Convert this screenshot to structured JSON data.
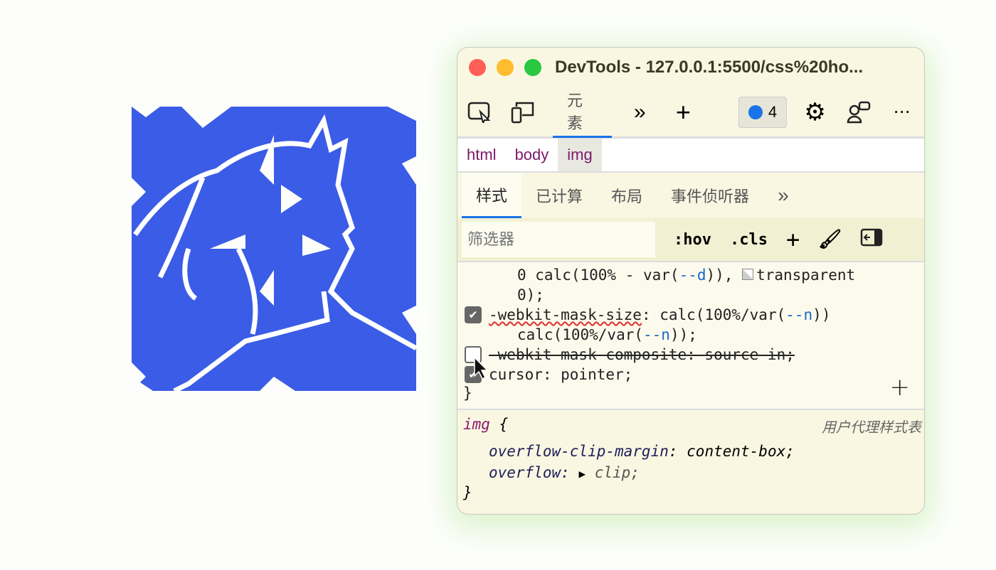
{
  "window": {
    "title": "DevTools - 127.0.0.1:5500/css%20ho...",
    "traffic_colors": [
      "#fe5f57",
      "#febc2e",
      "#28c840"
    ]
  },
  "toolbar": {
    "elements_tab": "元素",
    "issues_count": "4",
    "accent": "#1a73e8"
  },
  "breadcrumb": [
    "html",
    "body",
    "img"
  ],
  "subtabs": [
    "样式",
    "已计算",
    "布局",
    "事件侦听器"
  ],
  "filter": {
    "placeholder": "筛选器",
    "hov": ":hov",
    "cls": ".cls"
  },
  "rules": {
    "line1a": "0 calc(100% - var(",
    "line1var": "--d",
    "line1b": ")), ",
    "line1c": "transparent",
    "line2": "0);",
    "mask_size_prop": "-webkit-mask-size",
    "mask_size_v1": ": calc(100%/var(",
    "var_n": "--n",
    "mask_size_v1b": "))",
    "mask_size_v2a": "calc(100%/var(",
    "mask_size_v2b": "));",
    "composite": "-webkit-mask-composite: source-in;",
    "cursor_prop": "cursor",
    "cursor_val": ": pointer;",
    "close": "}"
  },
  "ua_rule": {
    "selector": "img",
    "open": " {",
    "source": "用户代理样式表",
    "p1": "overflow-clip-margin",
    "v1": ": content-box;",
    "p2": "overflow",
    "v2": "clip;",
    "close": "}"
  },
  "art": {
    "color": "#3b5ce6"
  }
}
